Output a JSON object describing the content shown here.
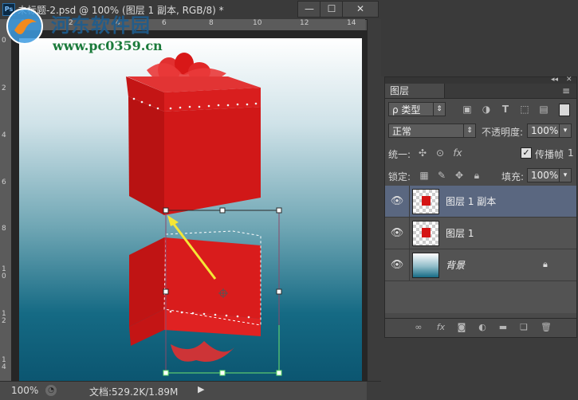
{
  "document": {
    "title": "未标题-2.psd @ 100% (图层 1 副本, RGB/8) *",
    "app_logo": "Ps",
    "window_buttons": {
      "minimize": "—",
      "maximize": "☐",
      "close": "✕"
    },
    "ruler_top_labels": [
      "0",
      "2",
      "4",
      "6",
      "8",
      "10",
      "12",
      "14"
    ],
    "ruler_left_labels": [
      "0",
      "2",
      "4",
      "6",
      "8",
      "1\n0",
      "1\n2",
      "1\n4"
    ],
    "status": {
      "zoom": "100%",
      "doc_info": "文档:529.2K/1.89M",
      "arrow": "▶"
    }
  },
  "watermark": {
    "name": "河东软件园",
    "url": "www.pc0359.cn"
  },
  "layers_panel": {
    "tab_label": "图层",
    "filter": {
      "value": "ρ 类型"
    },
    "blend_mode": "正常",
    "opacity_label": "不透明度:",
    "opacity_value": "100%",
    "unify_label": "统一:",
    "propagate_label": "传播帧",
    "propagate_value": "1",
    "propagate_checked": true,
    "lock_label": "锁定:",
    "fill_label": "填充:",
    "fill_value": "100%",
    "layers": [
      {
        "name": "图层 1 副本",
        "visible": true,
        "selected": true
      },
      {
        "name": "图层 1",
        "visible": true,
        "selected": false
      },
      {
        "name": "背景",
        "visible": true,
        "selected": false,
        "locked": true
      }
    ]
  },
  "colors": {
    "gift_red": "#d41414",
    "selection_handle": "#2a2a2a",
    "transform_green": "#6ee36e",
    "arrow_yellow": "#f5e636",
    "selected_layer_bg": "#5a6780"
  }
}
